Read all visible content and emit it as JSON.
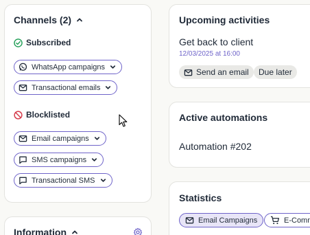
{
  "channels": {
    "title": "Channels (2)",
    "subscribed_label": "Subscribed",
    "subscribed": [
      {
        "label": "WhatsApp campaigns",
        "icon": "whatsapp-icon"
      },
      {
        "label": "Transactional emails",
        "icon": "mail-icon"
      }
    ],
    "blocklisted_label": "Blocklisted",
    "blocklisted": [
      {
        "label": "Email campaigns",
        "icon": "mail-icon"
      },
      {
        "label": "SMS campaigns",
        "icon": "message-icon"
      },
      {
        "label": "Transactional SMS",
        "icon": "message-icon"
      }
    ]
  },
  "information": {
    "title": "Information"
  },
  "upcoming": {
    "title": "Upcoming activities",
    "item_title": "Get back to client",
    "item_date": "12/03/2025 at 16:00",
    "tags": [
      {
        "label": "Send an email",
        "icon": "mail-icon"
      },
      {
        "label": "Due later"
      }
    ]
  },
  "automations": {
    "title": "Active automations",
    "item": "Automation #202"
  },
  "statistics": {
    "title": "Statistics",
    "tabs": [
      {
        "label": "Email Campaigns",
        "icon": "mail-icon",
        "active": true
      },
      {
        "label": "E-Comm",
        "icon": "cart-icon",
        "active": false
      }
    ]
  },
  "colors": {
    "accent": "#6e63c9",
    "success": "#1f9d55",
    "danger": "#d53a4a"
  }
}
